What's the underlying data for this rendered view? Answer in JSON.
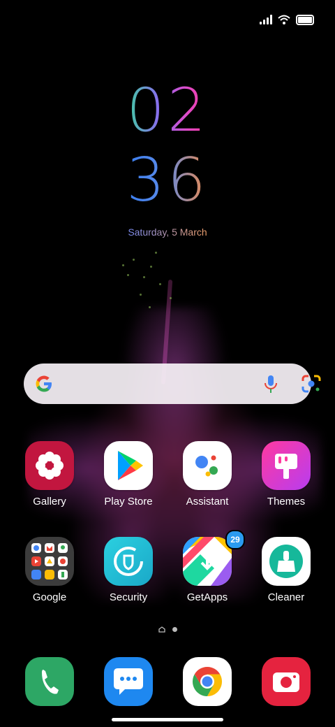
{
  "status_bar": {
    "signal_icon": "signal-icon",
    "wifi_icon": "wifi-icon",
    "battery_icon": "battery-icon"
  },
  "clock": {
    "hour": "02",
    "minute": "36",
    "date": "Saturday, 5 March"
  },
  "search": {
    "logo": "google-g-icon",
    "mic": "mic-icon",
    "lens": "lens-icon"
  },
  "apps_row1": [
    {
      "label": "Gallery",
      "icon": "gallery-icon"
    },
    {
      "label": "Play Store",
      "icon": "play-store-icon"
    },
    {
      "label": "Assistant",
      "icon": "assistant-icon"
    },
    {
      "label": "Themes",
      "icon": "themes-icon"
    }
  ],
  "apps_row2": [
    {
      "label": "Google",
      "icon": "google-folder-icon"
    },
    {
      "label": "Security",
      "icon": "security-icon"
    },
    {
      "label": "GetApps",
      "icon": "getapps-icon",
      "badge": "29"
    },
    {
      "label": "Cleaner",
      "icon": "cleaner-icon"
    }
  ],
  "dock": [
    {
      "icon": "phone-icon"
    },
    {
      "icon": "messages-icon"
    },
    {
      "icon": "chrome-icon"
    },
    {
      "icon": "camera-icon"
    }
  ],
  "colors": {
    "search_bg": "#f5f0f5",
    "badge": "#2a9bf0"
  }
}
